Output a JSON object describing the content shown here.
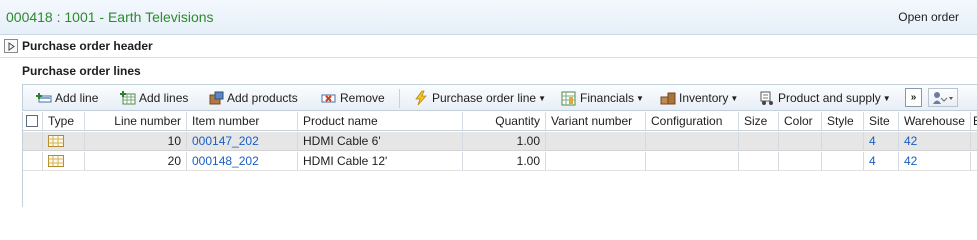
{
  "title": "000418 : 1001 - Earth Televisions",
  "status": "Open order",
  "header_fasttab": {
    "label": "Purchase order header"
  },
  "lines_section": {
    "title": "Purchase order lines"
  },
  "toolbar": {
    "add_line": "Add line",
    "add_lines": "Add lines",
    "add_products": "Add products",
    "remove": "Remove",
    "purchase_order_line": "Purchase order line",
    "financials": "Financials",
    "inventory": "Inventory",
    "product_and_supply": "Product and supply",
    "more": "»"
  },
  "grid": {
    "columns": {
      "type": "Type",
      "line_number": "Line number",
      "item_number": "Item number",
      "product_name": "Product name",
      "quantity": "Quantity",
      "variant_number": "Variant number",
      "configuration": "Configuration",
      "size": "Size",
      "color": "Color",
      "style": "Style",
      "site": "Site",
      "warehouse": "Warehouse",
      "overflow": "B"
    },
    "rows": [
      {
        "line_number": "10",
        "item_number": "000147_202",
        "product_name": "HDMI Cable 6'",
        "quantity": "1.00",
        "site": "4",
        "warehouse": "42"
      },
      {
        "line_number": "20",
        "item_number": "000148_202",
        "product_name": "HDMI Cable 12'",
        "quantity": "1.00",
        "site": "4",
        "warehouse": "42"
      }
    ]
  },
  "colors": {
    "title_green": "#2d8a2d",
    "link_blue": "#1a5ec4",
    "selected_row": "#e6e6e6"
  }
}
